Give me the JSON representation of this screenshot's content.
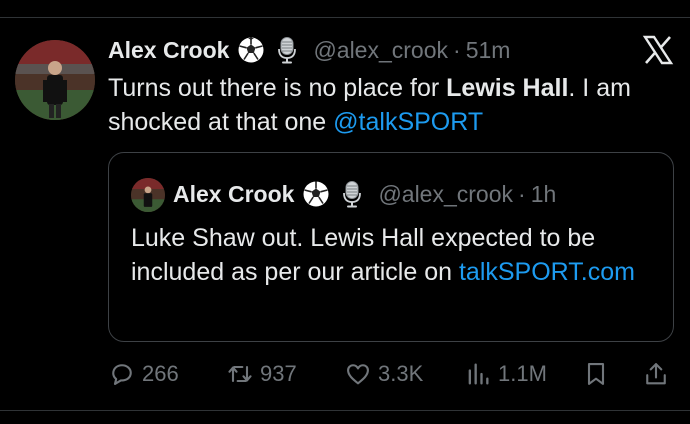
{
  "tweet": {
    "author_name": "Alex Crook",
    "emoji_1": "soccer-ball-icon",
    "emoji_2": "microphone-icon",
    "handle": "@alex_crook",
    "separator": "·",
    "time": "51m",
    "text_part1": "Turns out there is no place for ",
    "text_bold": "Lewis Hall",
    "text_part2": ". I am shocked at that one ",
    "mention": "@talkSPORT",
    "platform_icon": "x-logo-icon"
  },
  "quote": {
    "author_name": "Alex Crook",
    "handle": "@alex_crook",
    "separator": "·",
    "time": "1h",
    "text": "Luke Shaw out. Lewis Hall expected to be included as per our article on ",
    "link": "talkSPORT.com"
  },
  "actions": {
    "replies": "266",
    "reposts": "937",
    "likes": "3.3K",
    "views": "1.1M"
  },
  "colors": {
    "background": "#000000",
    "text": "#e7e9ea",
    "muted": "#71767b",
    "link": "#1d9bf0",
    "border": "#3d4145"
  }
}
